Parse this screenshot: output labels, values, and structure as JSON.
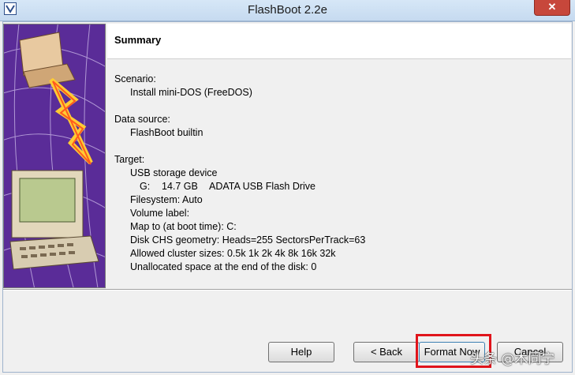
{
  "window": {
    "title": "FlashBoot 2.2e",
    "close_label": "✕"
  },
  "page": {
    "heading": "Summary"
  },
  "summary": {
    "scenario_label": "Scenario:",
    "scenario_value": "Install mini-DOS (FreeDOS)",
    "data_source_label": "Data source:",
    "data_source_value": "FlashBoot builtin",
    "target_label": "Target:",
    "target_device": "USB storage device",
    "drive_letter": "G:",
    "drive_size": "14.7 GB",
    "drive_name": "ADATA USB Flash Drive",
    "filesystem": "Filesystem: Auto",
    "volume_label": "Volume label:",
    "map_to": "Map to (at boot time): C:",
    "disk_chs": "Disk CHS geometry: Heads=255 SectorsPerTrack=63",
    "cluster_sizes": "Allowed cluster sizes: 0.5k 1k 2k 4k 8k 16k 32k",
    "unallocated": "Unallocated space at the end of the disk: 0"
  },
  "buttons": {
    "help": "Help",
    "back": "< Back",
    "format_now": "Format Now",
    "cancel": "Cancel"
  },
  "watermark": "头条 @木同宁",
  "colors": {
    "highlight": "#e0141b",
    "side_art_bg": "#5a2c98"
  }
}
